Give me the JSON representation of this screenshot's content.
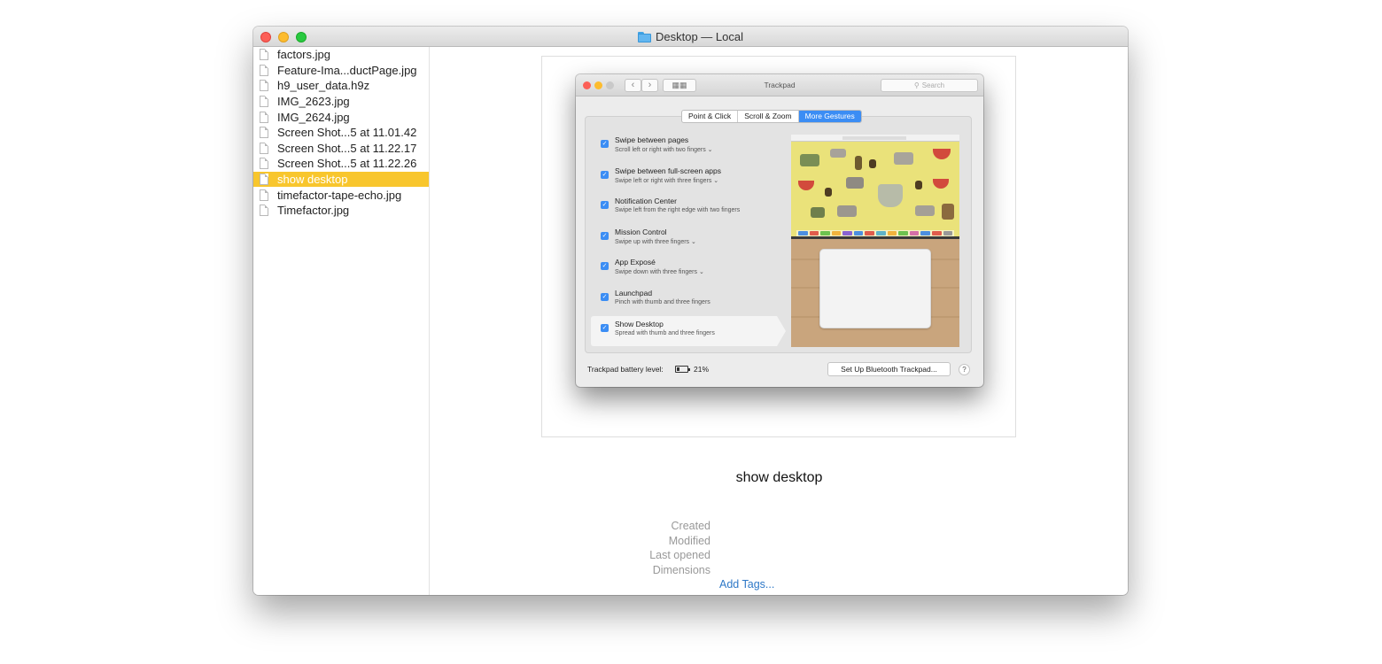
{
  "window": {
    "title": "Desktop — Local",
    "folder_icon": "folder-icon"
  },
  "sidebar": {
    "files": [
      {
        "name": "factors.jpg"
      },
      {
        "name": "Feature-Ima...ductPage.jpg"
      },
      {
        "name": "h9_user_data.h9z"
      },
      {
        "name": "IMG_2623.jpg"
      },
      {
        "name": "IMG_2624.jpg"
      },
      {
        "name": "Screen Shot...5 at 11.01.42"
      },
      {
        "name": "Screen Shot...5 at 11.22.17"
      },
      {
        "name": "Screen Shot...5 at 11.22.26"
      },
      {
        "name": "show desktop"
      },
      {
        "name": "timefactor-tape-echo.jpg"
      },
      {
        "name": "Timefactor.jpg"
      }
    ],
    "selected_index": 8,
    "selection_color": "#f8c62d"
  },
  "preview": {
    "file_title": "show desktop",
    "meta_labels": [
      "Created",
      "Modified",
      "Last opened",
      "Dimensions"
    ],
    "add_tags": "Add Tags..."
  },
  "thumbnail": {
    "window_title": "Trackpad",
    "search_placeholder": "Search",
    "tabs": [
      "Point & Click",
      "Scroll & Zoom",
      "More Gestures"
    ],
    "active_tab": 2,
    "accent_color": "#3b8df4",
    "gestures": [
      {
        "title": "Swipe between pages",
        "sub": "Scroll left or right with two fingers ⌄"
      },
      {
        "title": "Swipe between full-screen apps",
        "sub": "Swipe left or right with three fingers ⌄"
      },
      {
        "title": "Notification Center",
        "sub": "Swipe left from the right edge with two fingers"
      },
      {
        "title": "Mission Control",
        "sub": "Swipe up with three fingers ⌄"
      },
      {
        "title": "App Exposé",
        "sub": "Swipe down with three fingers ⌄"
      },
      {
        "title": "Launchpad",
        "sub": "Pinch with thumb and three fingers"
      },
      {
        "title": "Show Desktop",
        "sub": "Spread with thumb and three fingers"
      }
    ],
    "selected_gesture": 6,
    "battery_label": "Trackpad battery level:",
    "battery_level": "21%",
    "setup_button": "Set Up Bluetooth Trackpad...",
    "help_label": "?"
  }
}
